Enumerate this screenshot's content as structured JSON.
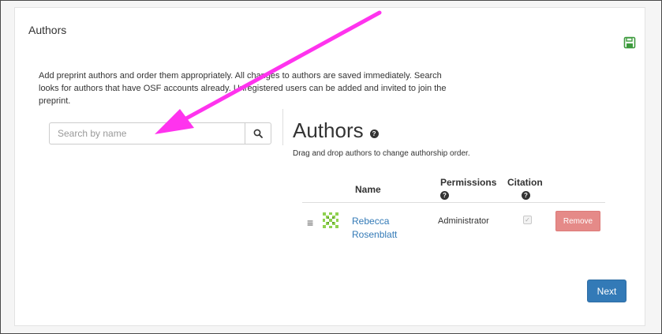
{
  "panel": {
    "title": "Authors",
    "intro": "Add preprint authors and order them appropriately. All changes to authors are saved immediately. Search looks for authors that have OSF accounts already. Unregistered users can be added and invited to join the preprint."
  },
  "search": {
    "placeholder": "Search by name",
    "value": ""
  },
  "authors_section": {
    "heading": "Authors",
    "drag_hint": "Drag and drop authors to change authorship order.",
    "columns": {
      "name": "Name",
      "permissions": "Permissions",
      "citation": "Citation"
    },
    "rows": [
      {
        "name": "Rebecca Rosenblatt",
        "permission": "Administrator",
        "citation_checked": true,
        "remove_label": "Remove"
      }
    ]
  },
  "buttons": {
    "next": "Next"
  },
  "icons": {
    "save": "save-icon",
    "search": "search-icon",
    "help": "question-circle-icon",
    "drag": "drag-handle-icon",
    "avatar": "identicon-avatar"
  },
  "colors": {
    "link": "#337ab7",
    "primary_button": "#337ab7",
    "danger_button": "#e58a88",
    "save_icon": "#3c9a3c",
    "annotation_arrow": "#ff33ee"
  }
}
